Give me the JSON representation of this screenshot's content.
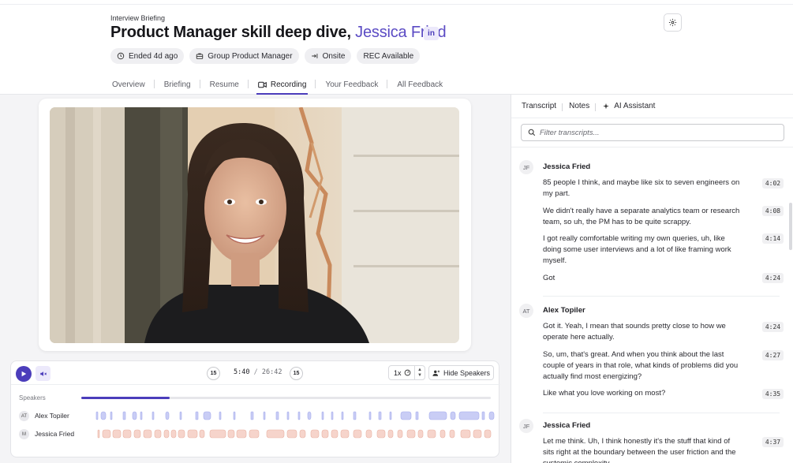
{
  "header": {
    "eyebrow": "Interview Briefing",
    "title_prefix": "Product Manager skill deep dive,",
    "candidate_name": "Jessica Fried",
    "linkedin_badge": "in",
    "chips": [
      {
        "icon": "clock-icon",
        "label": "Ended 4d ago"
      },
      {
        "icon": "briefcase-icon",
        "label": "Group Product Manager"
      },
      {
        "icon": "arrow-in-icon",
        "label": "Onsite"
      },
      {
        "icon": "rec-icon",
        "label": "REC Available"
      }
    ],
    "tabs": [
      {
        "label": "Overview",
        "active": false
      },
      {
        "label": "Briefing",
        "active": false
      },
      {
        "label": "Resume",
        "active": false
      },
      {
        "label": "Recording",
        "active": true,
        "icon": "video-icon"
      },
      {
        "label": "Your Feedback",
        "active": false
      },
      {
        "label": "All Feedback",
        "active": false
      }
    ]
  },
  "player": {
    "skip_back": "15",
    "skip_forward": "15",
    "current_time": "5:40",
    "separator": "/",
    "total_time": "26:42",
    "speed": "1x",
    "hide_speakers_label": "Hide Speakers",
    "speakers_label": "Speakers",
    "progress": 0.215,
    "speakers": [
      {
        "initials": "AT",
        "name": "Alex Topiler",
        "color": "#c9cdf5",
        "border": "#a7aded"
      },
      {
        "initials": "M",
        "name": "Jessica Fried",
        "color": "#f6d4cb",
        "border": "#e9b2a3"
      }
    ]
  },
  "sidebar": {
    "tabs": [
      {
        "label": "Transcript",
        "active": true
      },
      {
        "label": "Notes",
        "active": false
      },
      {
        "label": "AI Assistant",
        "active": false,
        "icon": "sparkle-icon"
      }
    ],
    "filter_placeholder": "Filter transcripts...",
    "blocks": [
      {
        "initials": "JF",
        "speaker": "Jessica Fried",
        "lines": [
          {
            "text": "85 people I think, and maybe like six to seven engineers on my part.",
            "ts": "4:02"
          },
          {
            "text": "We didn't really have a separate analytics team or research team, so uh, the PM has to be quite scrappy.",
            "ts": "4:08"
          },
          {
            "text": "I got really comfortable writing my own queries, uh, like doing some user interviews and a lot of like framing work myself.",
            "ts": "4:14"
          },
          {
            "text": "Got",
            "ts": "4:24"
          }
        ]
      },
      {
        "initials": "AT",
        "speaker": "Alex Topiler",
        "lines": [
          {
            "text": "Got it. Yeah, I mean that sounds pretty close to how we operate here actually.",
            "ts": "4:24"
          },
          {
            "text": "So, um, that's great. And when you think about the last couple of years in that role, what kinds of problems did you actually find most energizing?",
            "ts": "4:27"
          },
          {
            "text": "Like what you love working on most?",
            "ts": "4:35"
          }
        ]
      },
      {
        "initials": "JF",
        "speaker": "Jessica Fried",
        "lines": [
          {
            "text": "Let me think. Uh, I think honestly it's the stuff that kind of sits right at the boundary between the user friction and the systemic complexity.",
            "ts": "4:37"
          }
        ]
      }
    ]
  },
  "colors": {
    "accent": "#4b3dbb",
    "candidate_name": "#5b4bc4"
  }
}
